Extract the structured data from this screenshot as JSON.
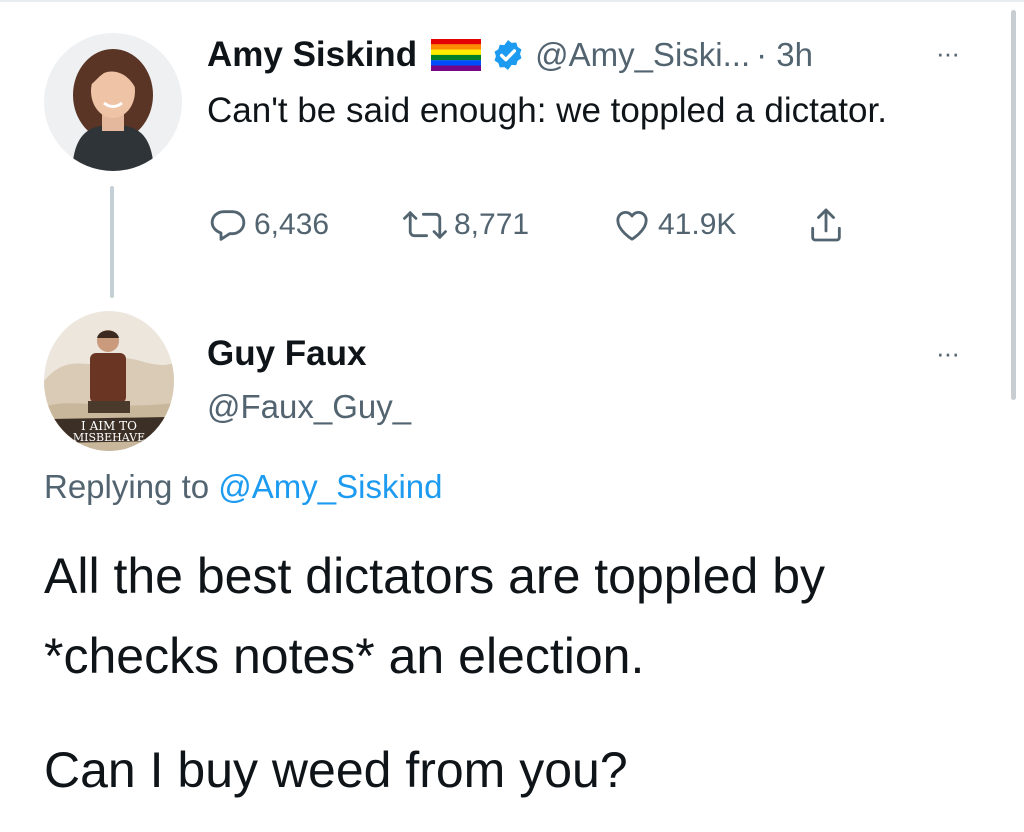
{
  "original_tweet": {
    "display_name": "Amy Siskind",
    "handle": "@Amy_Siski...",
    "time": "· 3h",
    "more": "···",
    "text": "Can't be said enough:  we toppled a dictator.",
    "icons": {
      "avatar": "avatar",
      "flag": "rainbow-flag-icon",
      "verified": "verified-badge-icon"
    },
    "actions": {
      "reply_count": "6,436",
      "retweet_count": "8,771",
      "like_count": "41.9K"
    },
    "colors": {
      "verified_blue": "#1d9bf0",
      "secondary_text": "#536471"
    }
  },
  "reply_tweet": {
    "display_name": "Guy Faux",
    "handle": "@Faux_Guy_",
    "more": "···",
    "avatar_caption_line1": "I AIM TO",
    "avatar_caption_line2": "MISBEHAVE",
    "replying_prefix": "Replying to ",
    "replying_mention": "@Amy_Siskind",
    "paragraph_1": "All the best dictators are toppled by *checks notes* an election.",
    "paragraph_2": "Can I buy weed from you?",
    "colors": {
      "mention_blue": "#1d9bf0"
    }
  }
}
